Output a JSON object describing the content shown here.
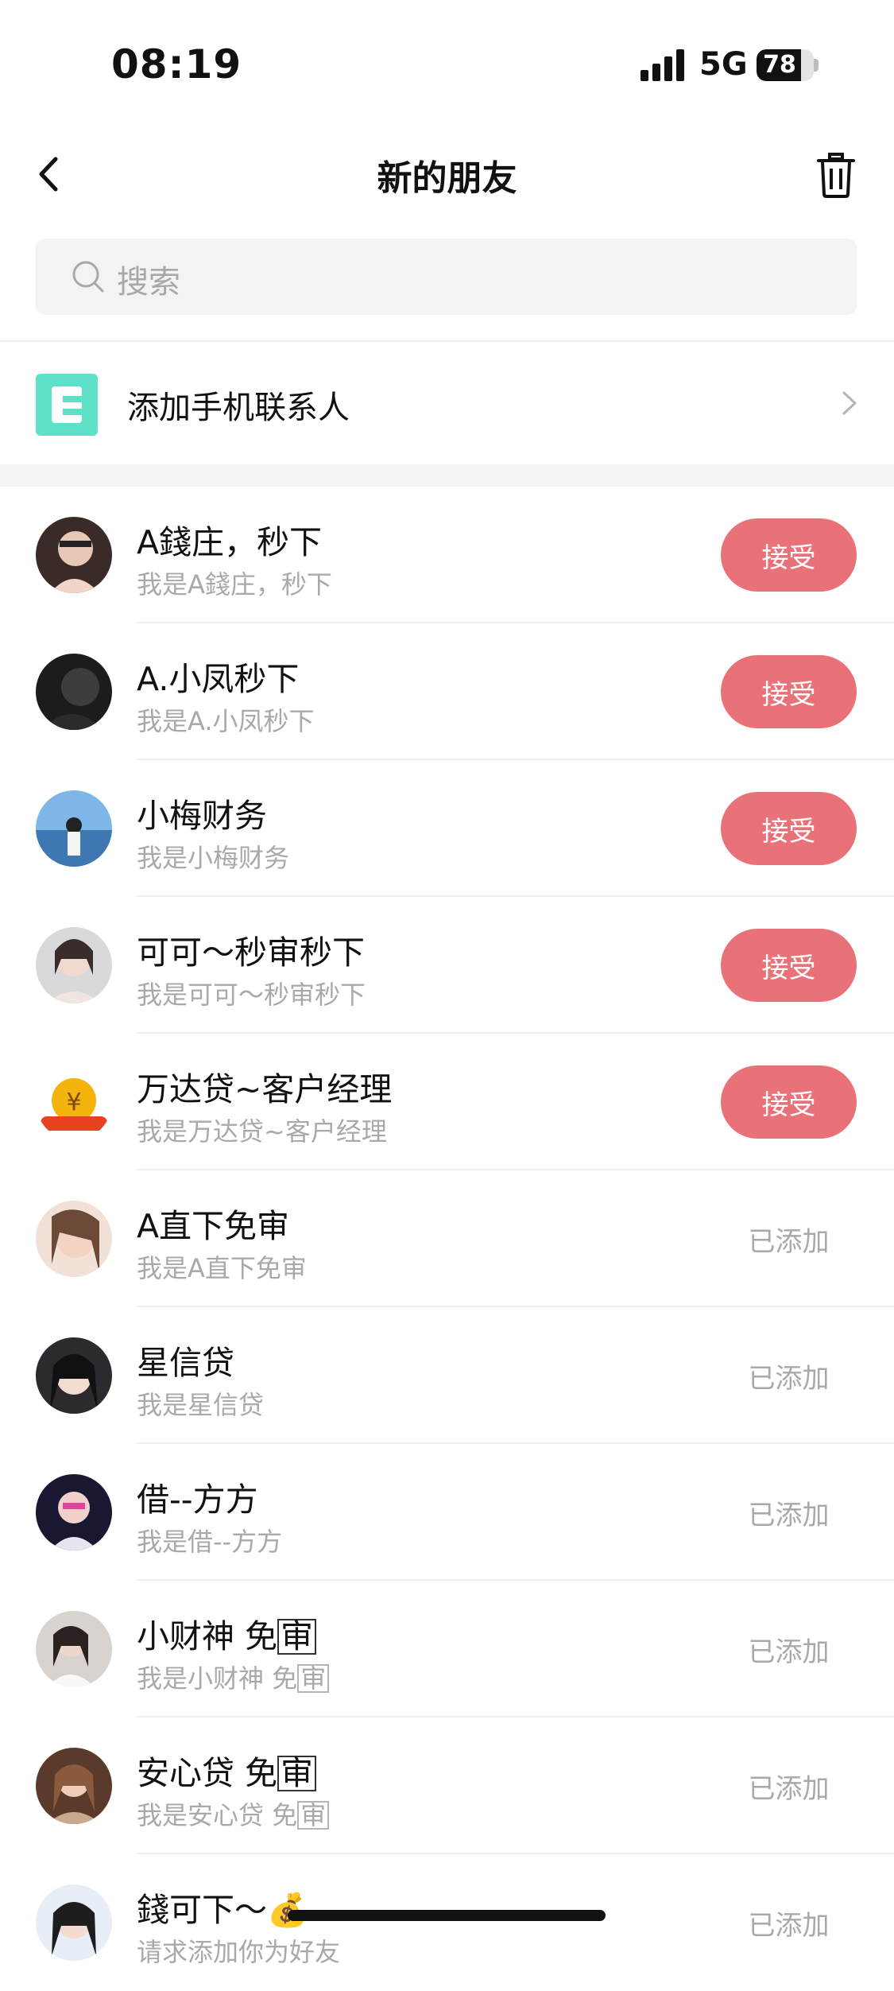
{
  "status_bar": {
    "time": "08:19",
    "network": "5G",
    "battery": "78"
  },
  "nav": {
    "title": "新的朋友",
    "back_icon": "chevron-left-icon",
    "trash_icon": "trash-icon"
  },
  "search": {
    "placeholder": "搜索",
    "icon": "search-icon"
  },
  "add_contacts": {
    "label": "添加手机联系人",
    "icon": "contacts-app-icon",
    "chevron": "chevron-right-icon"
  },
  "accent": "#e87278",
  "requests": [
    {
      "name": "A錢庄，秒下",
      "message": "我是A錢庄，秒下",
      "action": "接受",
      "state": "pending"
    },
    {
      "name": "A.小凤秒下",
      "message": "我是A.小凤秒下",
      "action": "接受",
      "state": "pending"
    },
    {
      "name": "小梅财务",
      "message": "我是小梅财务",
      "action": "接受",
      "state": "pending"
    },
    {
      "name": "可可～秒审秒下",
      "message": "我是可可～秒审秒下",
      "action": "接受",
      "state": "pending"
    },
    {
      "name": "万达贷~客户经理",
      "message": "我是万达贷~客户经理",
      "action": "接受",
      "state": "pending"
    },
    {
      "name": "A直下免审",
      "message": "我是A直下免审",
      "action": "已添加",
      "state": "added"
    },
    {
      "name": "星信贷",
      "message": "我是星信贷",
      "action": "已添加",
      "state": "added"
    },
    {
      "name": "借--方方",
      "message": "我是借--方方",
      "action": "已添加",
      "state": "added"
    },
    {
      "name_prefix": "小财神 免",
      "name_boxed": "审",
      "message_prefix": "我是小财神 免",
      "message_boxed": "审",
      "action": "已添加",
      "state": "added"
    },
    {
      "name_prefix": "安心贷 免",
      "name_boxed": "审",
      "message_prefix": "我是安心贷 免",
      "message_boxed": "审",
      "action": "已添加",
      "state": "added"
    },
    {
      "name": "錢可下～",
      "name_emoji": "💰",
      "message": "请求添加你为好友",
      "action": "已添加",
      "state": "added"
    }
  ]
}
